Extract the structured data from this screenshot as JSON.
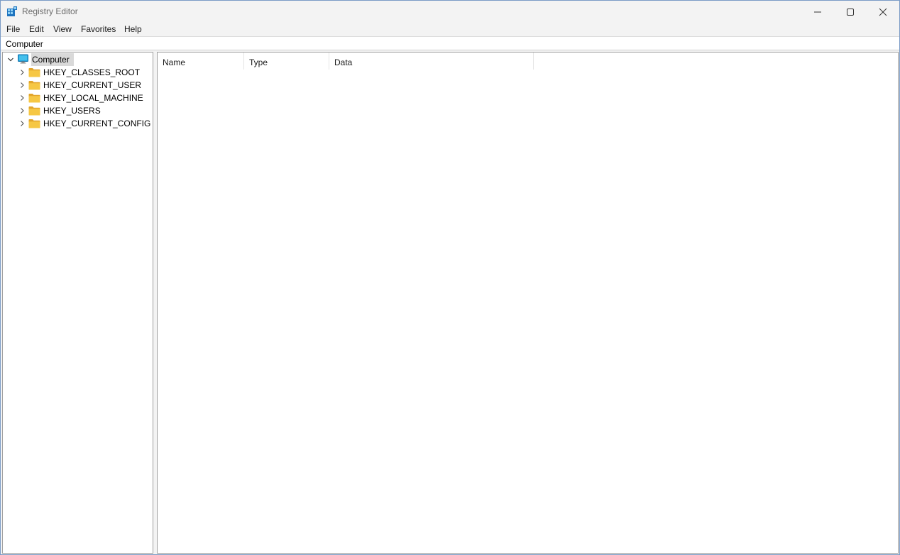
{
  "window": {
    "title": "Registry Editor",
    "icons": {
      "app": "registry-editor-icon",
      "minimize": "minimize-icon",
      "maximize": "maximize-icon",
      "close": "close-icon"
    }
  },
  "menu": {
    "items": [
      "File",
      "Edit",
      "View",
      "Favorites",
      "Help"
    ]
  },
  "address": {
    "path": "Computer"
  },
  "tree": {
    "root": {
      "label": "Computer",
      "expanded": true,
      "selected": true,
      "icon": "computer-icon"
    },
    "children": [
      {
        "label": "HKEY_CLASSES_ROOT",
        "icon": "folder-icon"
      },
      {
        "label": "HKEY_CURRENT_USER",
        "icon": "folder-icon"
      },
      {
        "label": "HKEY_LOCAL_MACHINE",
        "icon": "folder-icon"
      },
      {
        "label": "HKEY_USERS",
        "icon": "folder-icon"
      },
      {
        "label": "HKEY_CURRENT_CONFIG",
        "icon": "folder-icon"
      }
    ]
  },
  "list": {
    "columns": [
      "Name",
      "Type",
      "Data"
    ]
  },
  "colors": {
    "folder": "#f6c744",
    "folder_dark": "#e2a52b",
    "selection": "#d9d9d9",
    "accent": "#0f7ac6"
  }
}
